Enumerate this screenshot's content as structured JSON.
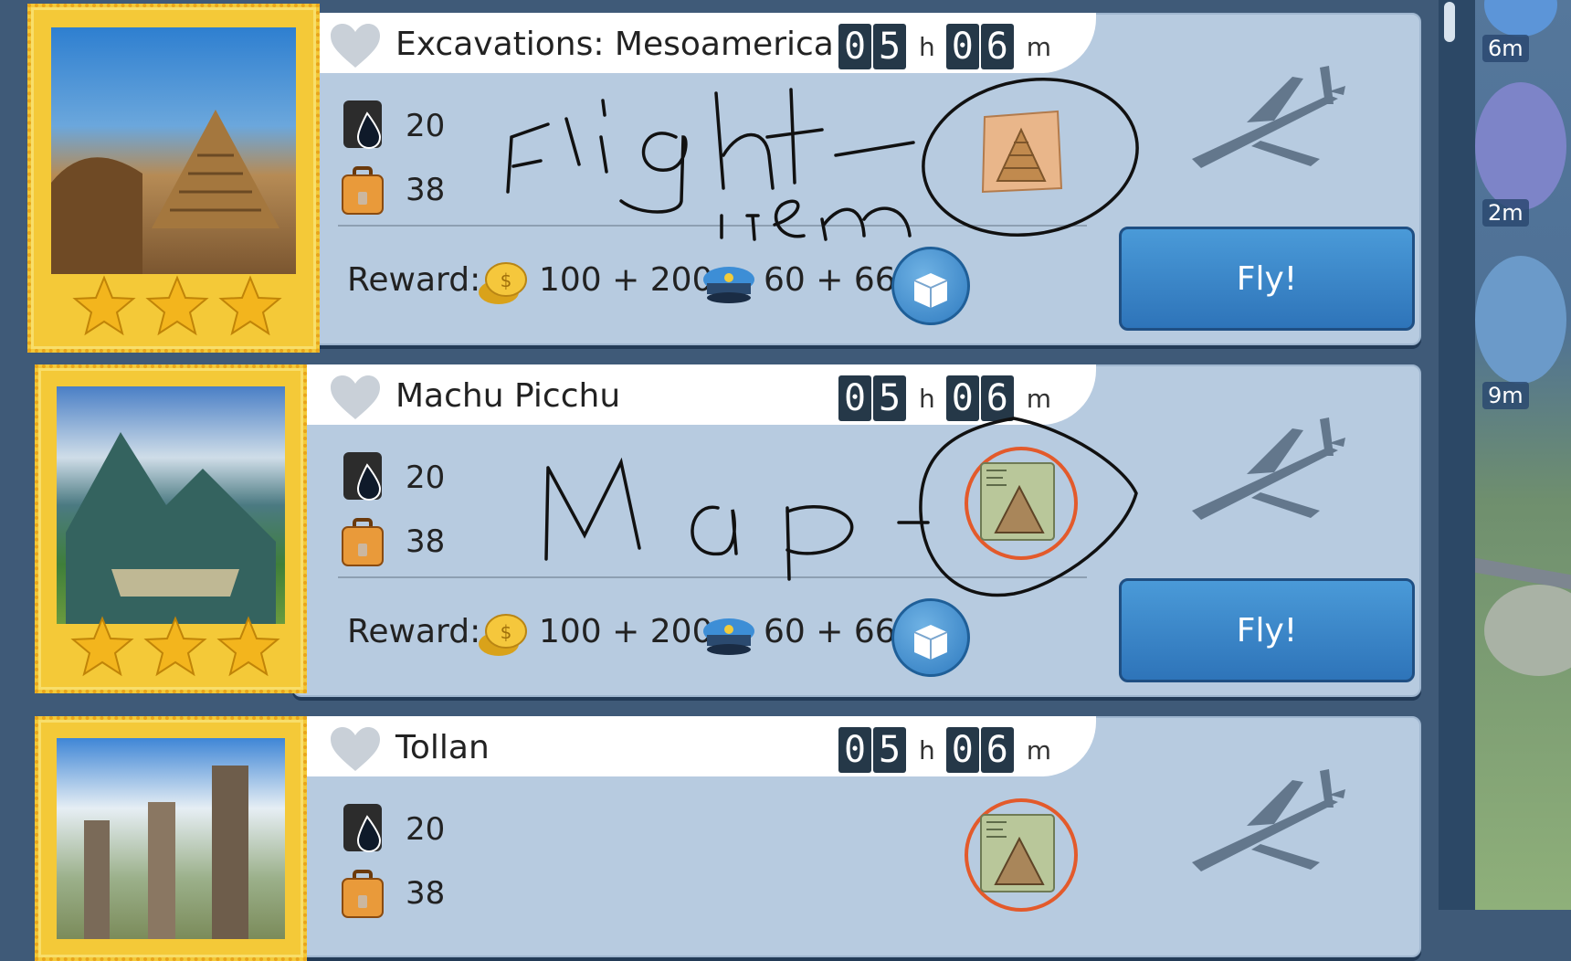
{
  "missions": [
    {
      "title": "Excavations: Mesoamerica",
      "hours_digits": [
        "0",
        "5"
      ],
      "hours_unit": "h",
      "minutes_digits": [
        "0",
        "6"
      ],
      "minutes_unit": "m",
      "fuel": "20",
      "luggage": "38",
      "reward_label": "Reward:",
      "coins": "100 + 200",
      "crew": "60 + 66",
      "fly_label": "Fly!",
      "stars": 3
    },
    {
      "title": "Machu Picchu",
      "hours_digits": [
        "0",
        "5"
      ],
      "hours_unit": "h",
      "minutes_digits": [
        "0",
        "6"
      ],
      "minutes_unit": "m",
      "fuel": "20",
      "luggage": "38",
      "reward_label": "Reward:",
      "coins": "100 + 200",
      "crew": "60 + 66",
      "fly_label": "Fly!",
      "stars": 3
    },
    {
      "title": "Tollan",
      "hours_digits": [
        "0",
        "5"
      ],
      "hours_unit": "h",
      "minutes_digits": [
        "0",
        "6"
      ],
      "minutes_unit": "m",
      "fuel": "20",
      "luggage": "38"
    }
  ],
  "side_timers": [
    "6m",
    "2m",
    "9m"
  ],
  "annotations": [
    "Flight item",
    "Map"
  ],
  "icons": {
    "heart": "heart-icon",
    "fuel": "fuel-barrel-icon",
    "luggage": "suitcase-icon",
    "coin": "coin-icon",
    "crew": "pilot-cap-icon",
    "box": "mystery-box-icon",
    "plane": "airplane-icon",
    "flight_item": "pyramid-parchment-icon",
    "map": "pyramid-map-icon"
  },
  "colors": {
    "panel": "#b7cbe0",
    "fly_button": "#2e74b9",
    "highlight_ring": "#e35a2b",
    "stamp": "#f4c938"
  }
}
